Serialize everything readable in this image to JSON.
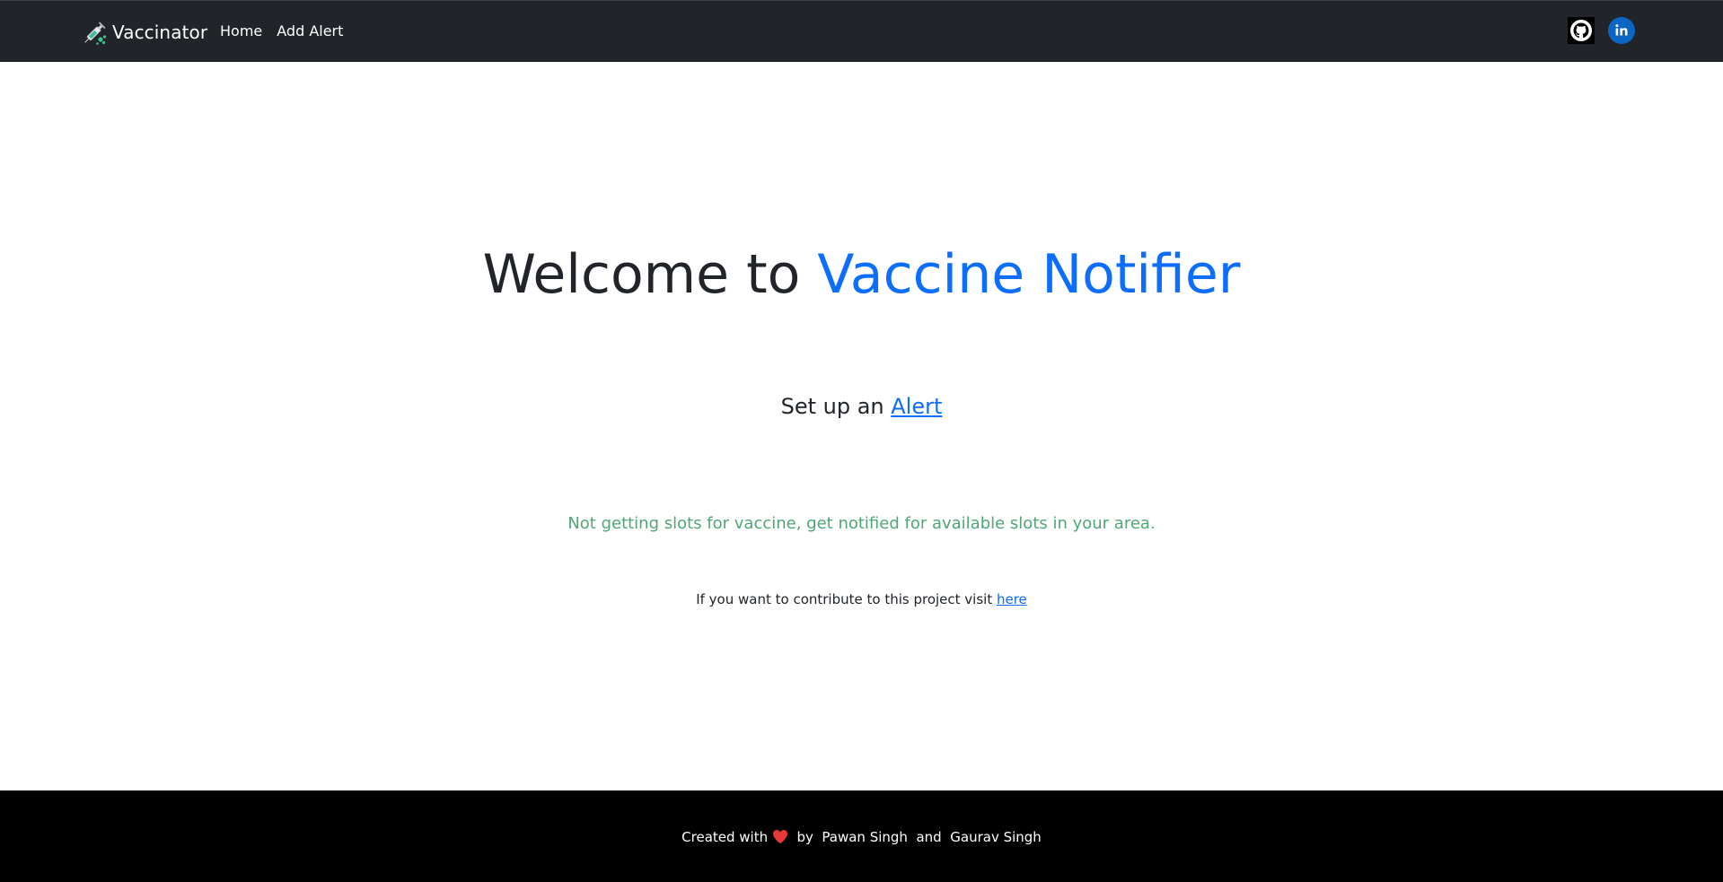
{
  "navbar": {
    "brand": {
      "label": "Vaccinator",
      "icon": "syringe-icon"
    },
    "links": [
      {
        "label": "Home"
      },
      {
        "label": "Add Alert"
      }
    ],
    "social": [
      {
        "icon": "github-icon"
      },
      {
        "icon": "linkedin-icon",
        "color": "#0a66c2"
      }
    ],
    "background": "#212529"
  },
  "main": {
    "title_prefix": "Welcome to ",
    "title_highlight": "Vaccine Notifier",
    "setup_prefix": "Set up an ",
    "setup_link": "Alert",
    "tagline": "Not getting slots for vaccine, get notified for available slots in your area.",
    "contribute_prefix": "If you want to contribute to this project visit ",
    "contribute_link": "here",
    "accent_color": "#0d6efd",
    "tagline_color": "#4fa776"
  },
  "footer": {
    "created_with": "Created with",
    "heart_icon": "heart-icon",
    "by": "by",
    "author_1": "Pawan Singh",
    "and": "and",
    "author_2": "Gaurav Singh",
    "background": "#000000"
  }
}
